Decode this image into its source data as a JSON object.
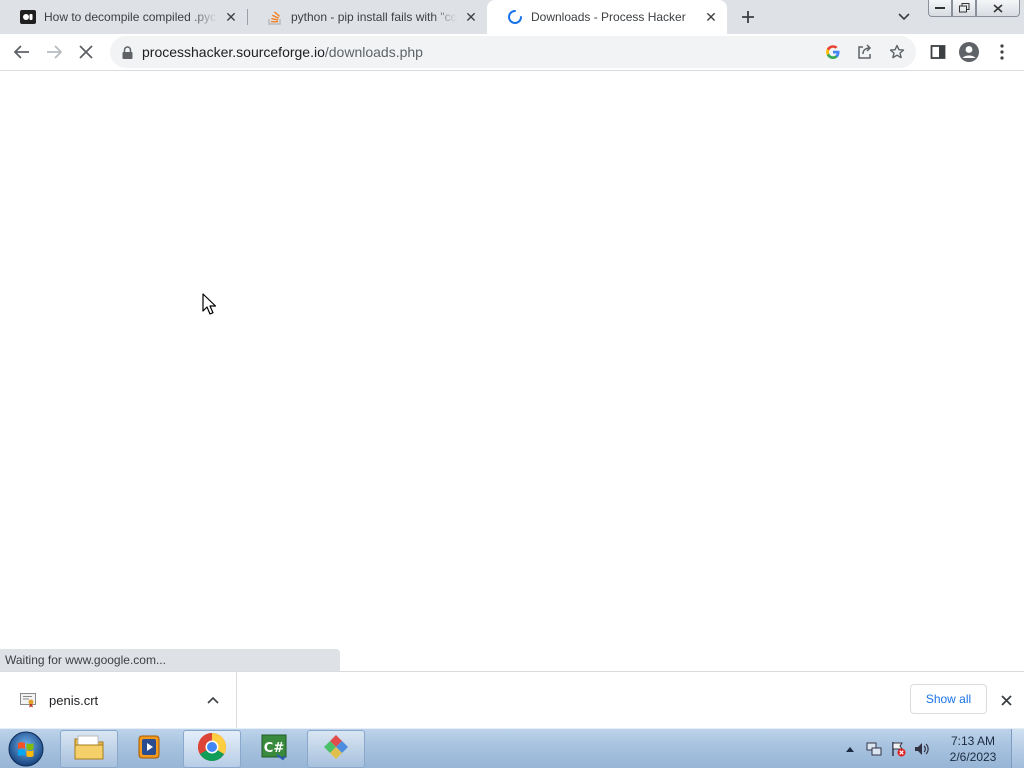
{
  "tabs": [
    {
      "title": "How to decompile compiled .pyc files",
      "icon": "bookmark-site-icon",
      "active": false
    },
    {
      "title": "python - pip install fails with \"connection error\"",
      "icon": "stackoverflow-icon",
      "active": false
    },
    {
      "title": "Downloads - Process Hacker",
      "icon": "loading-spinner-icon",
      "active": true
    }
  ],
  "toolbar": {
    "url_host": "processhacker.sourceforge.io",
    "url_path": "/downloads.php"
  },
  "status_text": "Waiting for www.google.com...",
  "downloads": {
    "file_name": "penis.crt",
    "show_all_label": "Show all"
  },
  "taskbar": {
    "time": "7:13 AM",
    "date": "2/6/2023",
    "apps": [
      "windows-explorer",
      "media-player",
      "google-chrome",
      "csharp-ide",
      "app-window"
    ]
  },
  "colors": {
    "tabstrip": "#dee1e6",
    "accent_blue": "#1a73e8"
  }
}
